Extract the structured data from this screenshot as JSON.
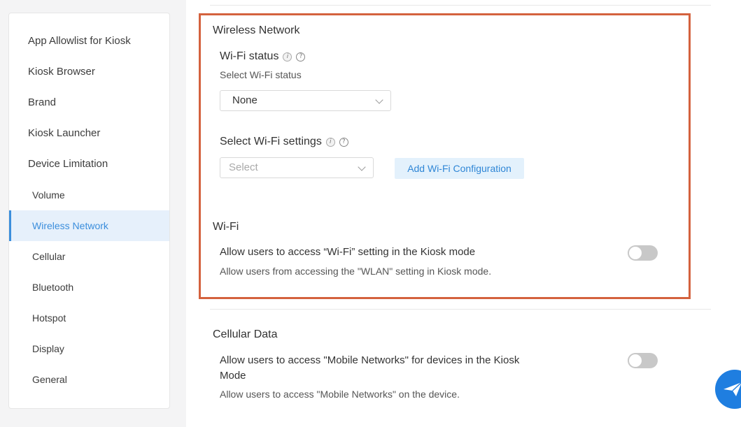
{
  "sidebar": {
    "items": [
      {
        "label": "App Allowlist for Kiosk"
      },
      {
        "label": "Kiosk Browser"
      },
      {
        "label": "Brand"
      },
      {
        "label": "Kiosk Launcher"
      },
      {
        "label": "Device Limitation"
      },
      {
        "label": "Volume"
      },
      {
        "label": "Wireless Network"
      },
      {
        "label": "Cellular"
      },
      {
        "label": "Bluetooth"
      },
      {
        "label": "Hotspot"
      },
      {
        "label": "Display"
      },
      {
        "label": "General"
      }
    ],
    "active": "Wireless Network"
  },
  "wireless": {
    "title": "Wireless Network",
    "wifi_status": {
      "label": "Wi-Fi status",
      "hint": "Select Wi-Fi status",
      "value": "None"
    },
    "wifi_settings": {
      "label": "Select Wi-Fi settings",
      "placeholder": "Select",
      "add_button": "Add Wi-Fi Configuration"
    }
  },
  "wifi": {
    "title": "Wi-Fi",
    "toggle_label": "Allow users to access “Wi-Fi” setting in the Kiosk mode",
    "toggle_desc": "Allow users from accessing the \"WLAN\" setting in Kiosk mode.",
    "enabled": false
  },
  "cellular": {
    "title": "Cellular Data",
    "toggle_label_line1": "Allow users to access \"Mobile Networks\" for devices in the Kiosk",
    "toggle_label_line2": "Mode",
    "toggle_desc": "Allow users to access \"Mobile Networks\" on the device.",
    "enabled": false
  },
  "icons": {
    "info": "info-icon",
    "help": "help-icon",
    "chevron": "chevron-down-icon",
    "fab": "paper-plane-icon"
  },
  "colors": {
    "accent": "#3b8edc",
    "highlight": "#d4623e",
    "fab": "#1f7ee0"
  }
}
